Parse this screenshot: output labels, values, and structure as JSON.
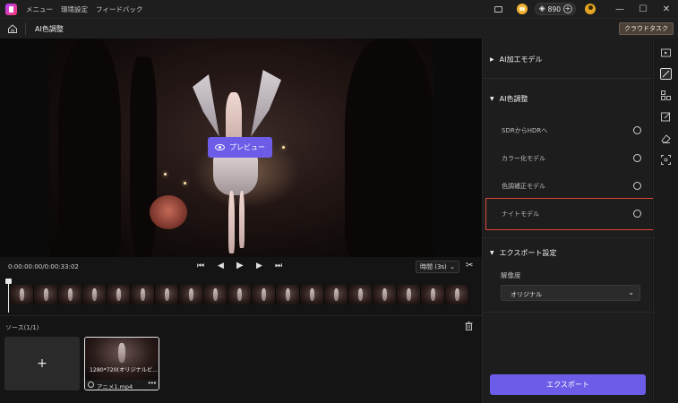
{
  "titlebar": {
    "menu": [
      "メニュー",
      "環境設定",
      "フィードバック"
    ],
    "credits": "890"
  },
  "header": {
    "title": "AI色調整",
    "cloud_button": "クラウドタスク"
  },
  "preview": {
    "button_label": "プレビュー"
  },
  "playback": {
    "timecode": "0:00:00:00/0:00:33:02",
    "zoom": "時間 (3s)"
  },
  "sources": {
    "label": "ソース(1/1)",
    "items": [
      {
        "resolution": "1280*720(オリジナルビ...",
        "name": "アニメ1.mp4"
      }
    ]
  },
  "panel": {
    "sections": {
      "ai_model": "AI加工モデル",
      "color": "AI色調整",
      "export": "エクスポート設定"
    },
    "options": [
      "SDRからHDRへ",
      "カラー化モデル",
      "色調補正モデル",
      "ナイトモデル"
    ],
    "resolution_label": "解像度",
    "resolution_value": "オリジナル",
    "export_button": "エクスポート"
  },
  "colors": {
    "accent": "#6c5ce7",
    "highlight": "#e2473a"
  }
}
